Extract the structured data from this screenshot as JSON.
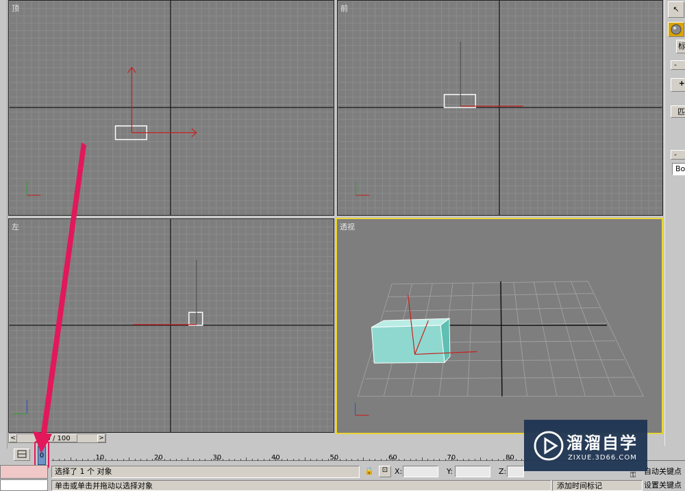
{
  "viewports": {
    "top": {
      "label": "顶"
    },
    "front": {
      "label": "前"
    },
    "left": {
      "label": "左"
    },
    "perspective": {
      "label": "透视"
    }
  },
  "time_slider": {
    "frame_display": "0 / 100",
    "prev_icon": "chevron-left-icon",
    "next_icon": "chevron-right-icon"
  },
  "trackbar": {
    "current_frame": "0",
    "tick_labels": [
      "10",
      "20",
      "30",
      "40",
      "50",
      "60",
      "70",
      "80"
    ]
  },
  "status": {
    "prompt": "选择了 1 个 对象",
    "hint": "单击或单击并拖动以选择对象",
    "x_label": "X:",
    "y_label": "Y:",
    "z_label": "Z:"
  },
  "animation": {
    "auto_key": "自动关键点",
    "set_key": "设置关键点",
    "add_time_tag": "添加时间标记"
  },
  "command_panel": {
    "tab_fragment": "标",
    "minus_1": "-",
    "plus": "+",
    "fragment_2": "匹",
    "minus_2": "-",
    "object_name_fragment": "Box"
  },
  "watermark": {
    "title": "溜溜自学",
    "url": "ZIXUE.3D66.COM"
  },
  "colors": {
    "active_viewport": "#e9d531",
    "gizmo_red": "#c81e1e",
    "box_cyan": "#8fd8cf",
    "annotation_arrow": "#e2185a"
  }
}
